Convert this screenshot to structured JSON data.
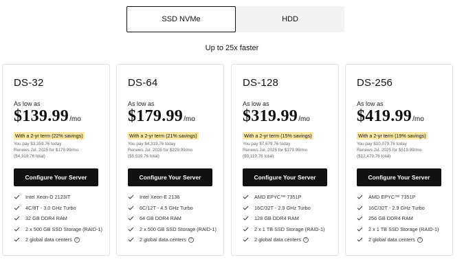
{
  "storage_toggle": {
    "options": [
      {
        "label": "SSD NVMe",
        "selected": true
      },
      {
        "label": "HDD",
        "selected": false
      }
    ]
  },
  "tagline": "Up to 25x faster",
  "plans": [
    {
      "name": "DS-32",
      "as_low_as": "As low as",
      "price": "$139.99",
      "per": "/mo",
      "term_badge": "With a 2-yr term (22% savings)",
      "pay_today": "You pay $3,359.76 today",
      "renews": "Renews Jul. 2025 for $179.99/mo",
      "renew_total": "($4,319.76 total)",
      "cta": "Configure Your Server",
      "features": [
        "Intel Xeon-D 2123IT",
        "4C/8T - 3.0 GHz Turbo",
        "32 GB DDR4 RAM",
        "2 x 500 GB SSD Storage (RAID-1)",
        "2 global data centers"
      ]
    },
    {
      "name": "DS-64",
      "as_low_as": "As low as",
      "price": "$179.99",
      "per": "/mo",
      "term_badge": "With a 2-yr term (21% savings)",
      "pay_today": "You pay $4,319.76 today",
      "renews": "Renews Jul. 2025 for $229.99/mo",
      "renew_total": "($5,519.76 total)",
      "cta": "Configure Your Server",
      "features": [
        "Intel Xeon-E 2136",
        "6C/12T - 4.5 GHz Turbo",
        "64 GB DDR4 RAM",
        "2 x 500 GB SSD Storage (RAID-1)",
        "2 global data centers"
      ]
    },
    {
      "name": "DS-128",
      "as_low_as": "As low as",
      "price": "$319.99",
      "per": "/mo",
      "term_badge": "With a 2-yr term (15% savings)",
      "pay_today": "You pay $7,679.76 today",
      "renews": "Renews Jul. 2025 for $379.99/mo",
      "renew_total": "($9,119.76 total)",
      "cta": "Configure Your Server",
      "features": [
        "AMD EPYC™ 7351P",
        "16C/32T - 2.9 GHz Turbo",
        "128 GB DDR4 RAM",
        "2 x 1 TB SSD Storage (RAID-1)",
        "2 global data centers"
      ]
    },
    {
      "name": "DS-256",
      "as_low_as": "As low as",
      "price": "$419.99",
      "per": "/mo",
      "term_badge": "With a 2-yr term (19% savings)",
      "pay_today": "You pay $10,079.76 today",
      "renews": "Renews Jul. 2025 for $519.99/mo",
      "renew_total": "($12,479.76 total)",
      "cta": "Configure Your Server",
      "features": [
        "AMD EPYC™ 7351P",
        "16C/32T - 2.9 GHz Turbo",
        "256 GB DDR4 RAM",
        "2 x 1 TB SSD Storage (RAID-1)",
        "2 global data centers"
      ]
    }
  ],
  "help_icon": {
    "name": "question-circle-icon",
    "glyph": "?"
  },
  "colors": {
    "badge_bg": "#fbe8a6",
    "cta_bg": "#111111",
    "check": "#333333"
  }
}
